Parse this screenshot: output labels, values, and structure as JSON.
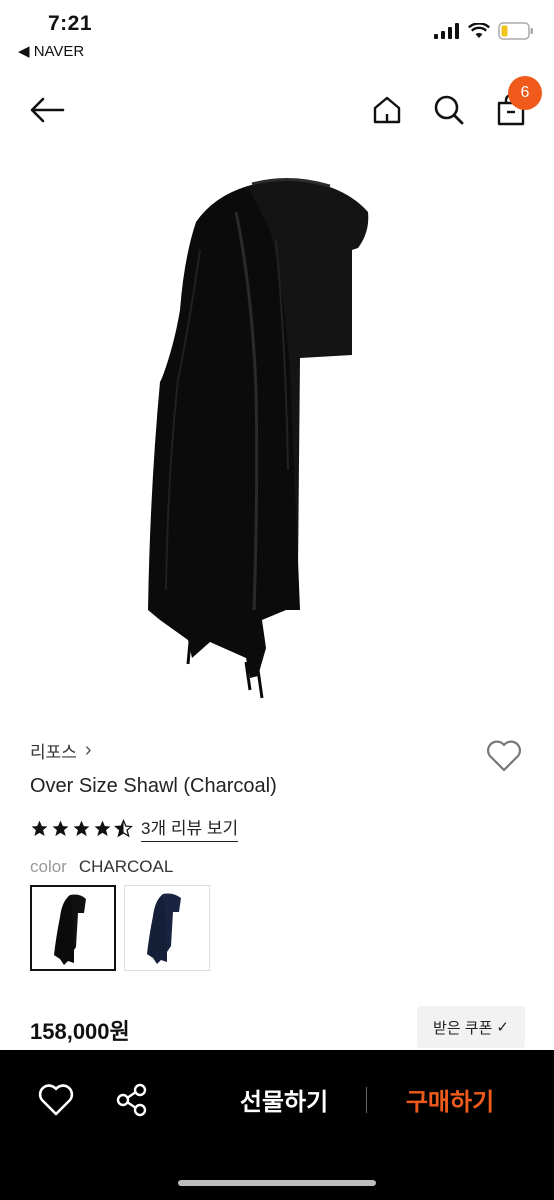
{
  "status_bar": {
    "time": "7:21",
    "back_app": "◀ NAVER"
  },
  "header": {
    "cart_count": "6"
  },
  "product": {
    "brand": "리포스",
    "brand_chevron": "›",
    "name": "Over Size Shawl (Charcoal)",
    "rating": 4.5,
    "review_link": "3개 리뷰 보기",
    "color_label": "color",
    "color_value": "CHARCOAL",
    "swatches": [
      {
        "name": "charcoal",
        "color": "#111111"
      },
      {
        "name": "navy",
        "color": "#1c2a4a"
      }
    ],
    "price": "158,000원",
    "coupon_label": "받은 쿠폰",
    "coupon_check": "✓"
  },
  "bottom_bar": {
    "gift_label": "선물하기",
    "buy_label": "구매하기"
  },
  "colors": {
    "accent": "#f05a1a",
    "bottom_bg": "#000000"
  }
}
